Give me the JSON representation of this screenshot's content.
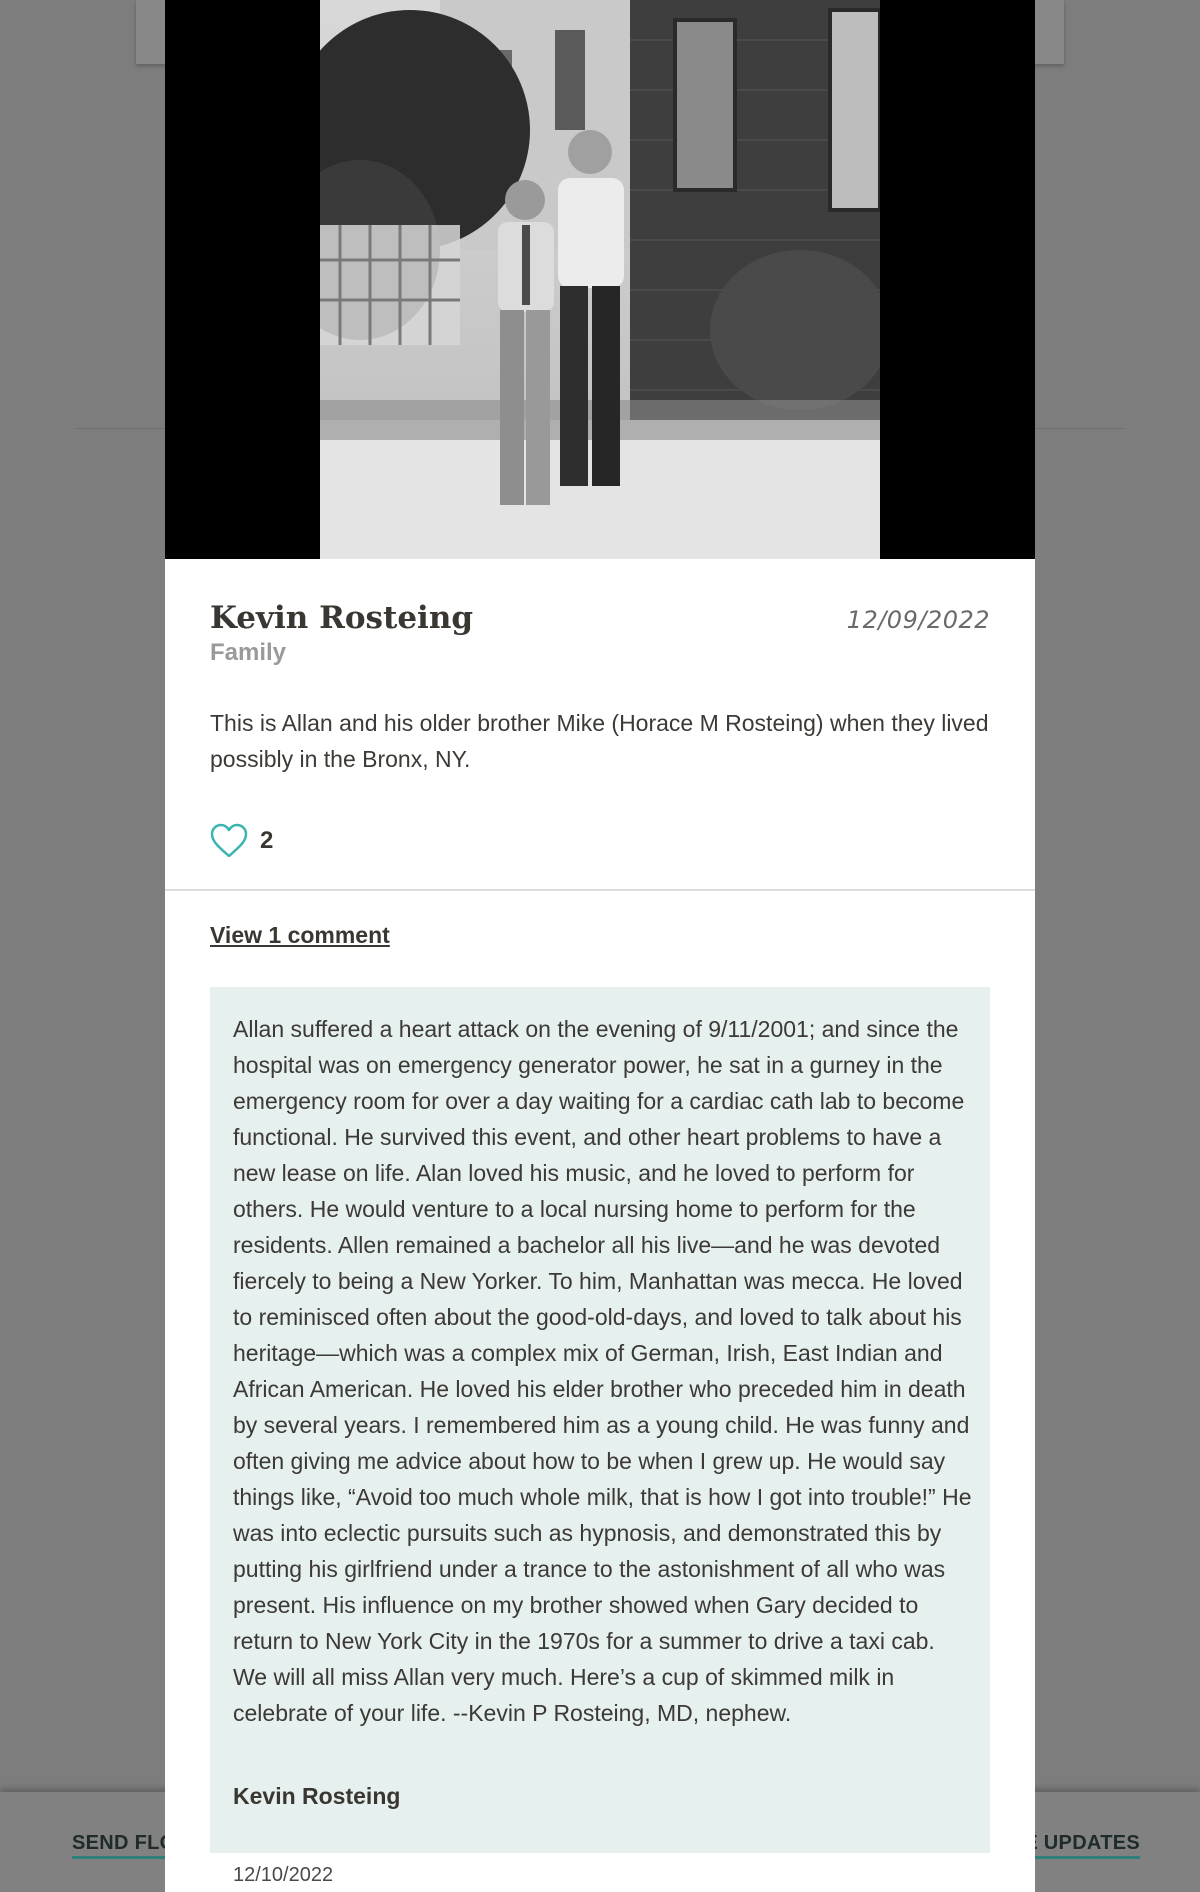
{
  "background": {
    "footer_left_link": "SEND FLO",
    "footer_right_link": "E UPDATES"
  },
  "modal": {
    "photo_description_icon": "photo",
    "author": "Kevin Rosteing",
    "relationship": "Family",
    "date": "12/09/2022",
    "caption": "This is Allan and his older brother Mike (Horace M Rosteing) when they lived possibly in the Bronx, NY.",
    "likes": {
      "icon": "heart-icon",
      "count": "2"
    },
    "view_comments_label": "View 1 comment",
    "comment": {
      "text": "Allan suffered a heart attack on the evening of 9/11/2001; and since the hospital was on emergency generator power, he sat in a gurney in the emergency room for over a day waiting for a cardiac cath lab to become functional. He survived this event, and other heart problems to have a new lease on life. Alan loved his music, and he loved to perform for others. He would venture to a local nursing home to perform for the residents. Allen remained a bachelor all his live—and he was devoted fiercely to being a New Yorker. To him, Manhattan was mecca. He loved to reminisced often about the good-old-days, and loved to talk about his heritage—which was a complex mix of German, Irish, East Indian and African American. He loved his elder brother who preceded him in death by several years. I remembered him as a young child. He was funny and often giving me advice about how to be when I grew up. He would say things like, “Avoid too much whole milk, that is how I got into trouble!” He was into eclectic pursuits such as hypnosis, and demonstrated this by putting his girlfriend under a trance to the astonishment of all who was present. His influence on my brother showed when Gary decided to return to New York City in the 1970s for a summer to drive a taxi cab. We will all miss Allan very much. Here’s a cup of skimmed milk in celebrate of your life. --Kevin P Rosteing, MD, nephew.",
      "author": "Kevin Rosteing",
      "date": "12/10/2022"
    }
  },
  "colors": {
    "accent_teal": "#3bb5b0",
    "comment_bg": "#e5f0ef",
    "overlay": "#7d7d7d"
  }
}
